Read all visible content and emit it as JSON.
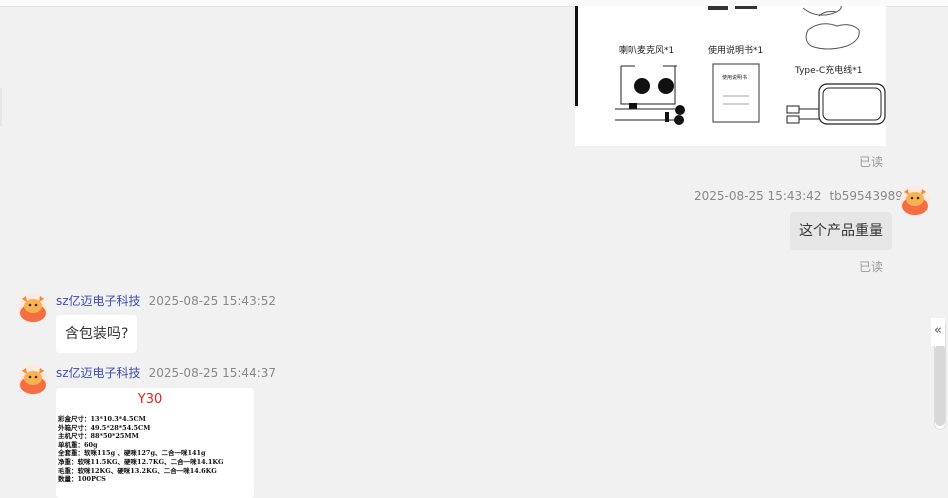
{
  "product_image": {
    "labels": {
      "mic": "喇叭麦克风*1",
      "manual": "使用说明书*1",
      "cable": "Type-C充电线*1",
      "manual_cover": "使用说明书"
    }
  },
  "messages": [
    {
      "id": "read1",
      "read_label": "已读"
    },
    {
      "id": "msg_user",
      "timestamp": "2025-08-25 15:43:42",
      "sender": "tb5954398910",
      "text": "这个产品重量",
      "read_label": "已读"
    },
    {
      "id": "msg_shop1",
      "sender": "sz亿迈电子科技",
      "timestamp": "2025-08-25 15:43:52",
      "text": "含包装吗?"
    },
    {
      "id": "msg_shop2",
      "sender": "sz亿迈电子科技",
      "timestamp": "2025-08-25 15:44:37",
      "spec_image": {
        "title": "Y30",
        "lines": [
          "彩盒尺寸：13*10.3*4.5CM",
          "外箱尺寸：49.5*28*54.5CM",
          "主机尺寸：88*50*25MM",
          "单机重：60g",
          "全套重：软咪115g 、硬咪127g、二合一咪141g",
          "净重：软咪11.5KG、硬咪12.7KG、二合一咪14.1KG",
          "毛重：软咪12KG、硬咪13.2KG、二合一咪14.6KG",
          "数量：100PCS"
        ]
      }
    }
  ],
  "ui": {
    "collapse_icon": "double-chevron-left-icon",
    "collapse_glyph": "«"
  },
  "colors": {
    "sender_name": "#3a4dbb",
    "spec_title": "#e0241c",
    "background": "#f1f1f1"
  }
}
